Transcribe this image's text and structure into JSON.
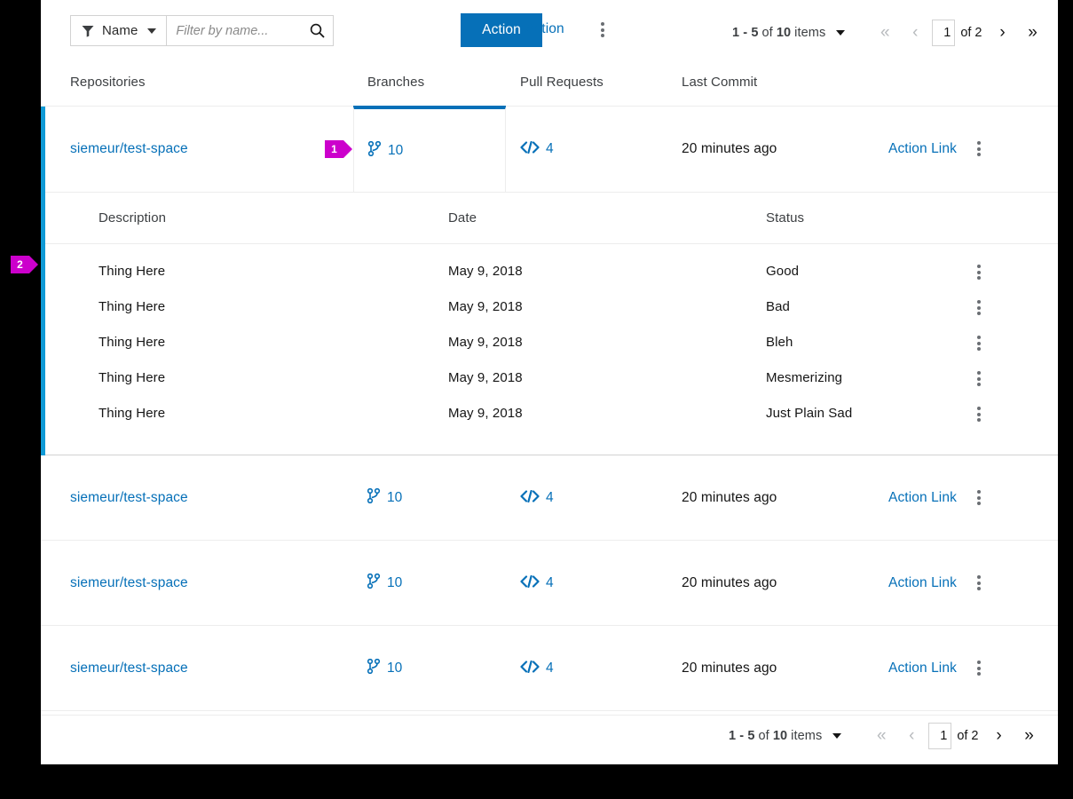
{
  "toolbar": {
    "filter": {
      "label": "Name",
      "icon": "funnel-icon"
    },
    "search": {
      "value": "",
      "placeholder": "Filter by name..."
    },
    "primary_action": "Action",
    "secondary_action": "Action",
    "overflow_icon": "kebab-icon"
  },
  "pagination": {
    "range": "1 - 5",
    "of_word": "of",
    "total": "10",
    "items_word": "items",
    "first_label": "«",
    "prev_label": "‹",
    "page_value": "1",
    "page_of": "of 2",
    "next_label": "›",
    "last_label": "»"
  },
  "columns": {
    "repositories": "Repositories",
    "branches": "Branches",
    "pull_requests": "Pull Requests",
    "last_commit": "Last Commit"
  },
  "rows": [
    {
      "repo": "siemeur/test-space",
      "branches": "10",
      "pull_requests": "4",
      "last_commit": "20 minutes ago",
      "action": "Action Link"
    },
    {
      "repo": "siemeur/test-space",
      "branches": "10",
      "pull_requests": "4",
      "last_commit": "20 minutes ago",
      "action": "Action Link"
    },
    {
      "repo": "siemeur/test-space",
      "branches": "10",
      "pull_requests": "4",
      "last_commit": "20 minutes ago",
      "action": "Action Link"
    },
    {
      "repo": "siemeur/test-space",
      "branches": "10",
      "pull_requests": "4",
      "last_commit": "20 minutes ago",
      "action": "Action Link"
    }
  ],
  "detail": {
    "headers": {
      "description": "Description",
      "date": "Date",
      "status": "Status"
    },
    "rows": [
      {
        "description": "Thing Here",
        "date": "May 9, 2018",
        "status": "Good"
      },
      {
        "description": "Thing Here",
        "date": "May 9, 2018",
        "status": "Bad"
      },
      {
        "description": "Thing Here",
        "date": "May 9, 2018",
        "status": "Bleh"
      },
      {
        "description": "Thing Here",
        "date": "May 9, 2018",
        "status": "Mesmerizing"
      },
      {
        "description": "Thing Here",
        "date": "May 9, 2018",
        "status": "Just Plain Sad"
      }
    ]
  },
  "callouts": [
    {
      "number": "1"
    },
    {
      "number": "2"
    }
  ],
  "colors": {
    "accent_blue": "#0670b8",
    "select_bar": "#0f9ad6",
    "callout_magenta": "#cc00cc"
  }
}
